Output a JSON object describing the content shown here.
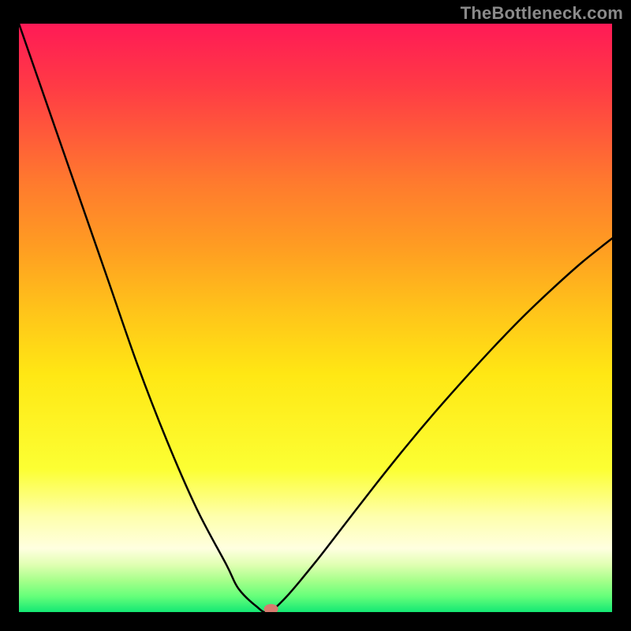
{
  "watermark": "TheBottleneck.com",
  "chart_data": {
    "type": "line",
    "title": "",
    "xlabel": "",
    "ylabel": "",
    "xlim": [
      0,
      100
    ],
    "ylim": [
      0,
      100
    ],
    "x": [
      0,
      5,
      10,
      15,
      20,
      25,
      30,
      35,
      37,
      40,
      42,
      45,
      50,
      55,
      60,
      65,
      70,
      75,
      80,
      85,
      90,
      95,
      100
    ],
    "values": [
      100,
      85.5,
      71,
      56.5,
      42,
      29,
      17.5,
      8,
      4,
      1,
      0,
      2.5,
      8.5,
      15,
      21.5,
      27.8,
      33.8,
      39.5,
      45,
      50.2,
      55,
      59.5,
      63.5
    ],
    "marker": {
      "x": 42.5,
      "y": 0.5
    },
    "background_gradient": {
      "stops": [
        {
          "offset": 0.0,
          "color": "#ff1a56"
        },
        {
          "offset": 0.108,
          "color": "#ff3b45"
        },
        {
          "offset": 0.27,
          "color": "#ff7a2e"
        },
        {
          "offset": 0.378,
          "color": "#ff9c22"
        },
        {
          "offset": 0.486,
          "color": "#ffc31a"
        },
        {
          "offset": 0.595,
          "color": "#ffe714"
        },
        {
          "offset": 0.757,
          "color": "#fcff33"
        },
        {
          "offset": 0.838,
          "color": "#feffad"
        },
        {
          "offset": 0.892,
          "color": "#ffffe0"
        },
        {
          "offset": 0.919,
          "color": "#e1ffb3"
        },
        {
          "offset": 0.946,
          "color": "#a7ff8b"
        },
        {
          "offset": 0.973,
          "color": "#66ff7a"
        },
        {
          "offset": 1.0,
          "color": "#14e874"
        }
      ]
    },
    "marker_fill": "#d87b6f",
    "curve_stroke": "#000000",
    "curve_width": 2.5
  }
}
